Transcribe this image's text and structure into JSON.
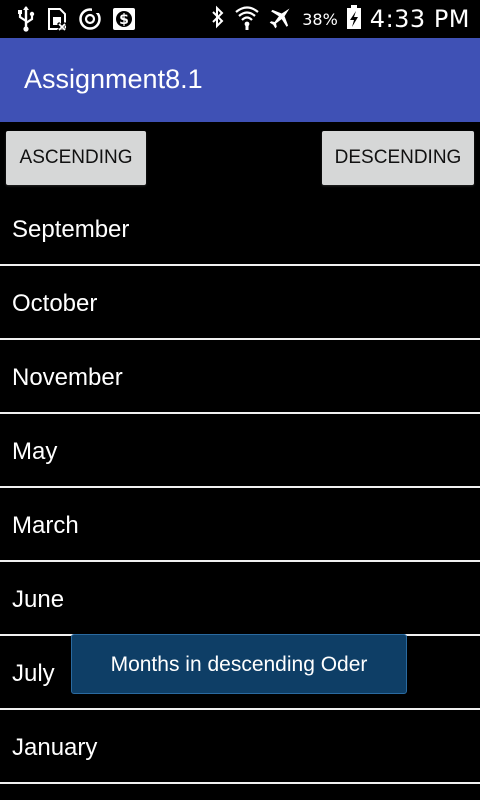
{
  "status_bar": {
    "left_icons": [
      "usb-icon",
      "sim-card-icon",
      "sync-icon",
      "dollar-app-icon"
    ],
    "right_icons": [
      "bluetooth-icon",
      "wifi-icon",
      "airplane-icon",
      "battery-charging-icon"
    ],
    "battery": "38%",
    "time": "4:33 PM"
  },
  "app_bar": {
    "title": "Assignment8.1",
    "color": "#3f51b5"
  },
  "buttons": {
    "ascending": "ASCENDING",
    "descending": "DESCENDING"
  },
  "months": [
    "September",
    "October",
    "November",
    "May",
    "March",
    "June",
    "July",
    "January"
  ],
  "toast": {
    "message": "Months in descending Oder"
  }
}
